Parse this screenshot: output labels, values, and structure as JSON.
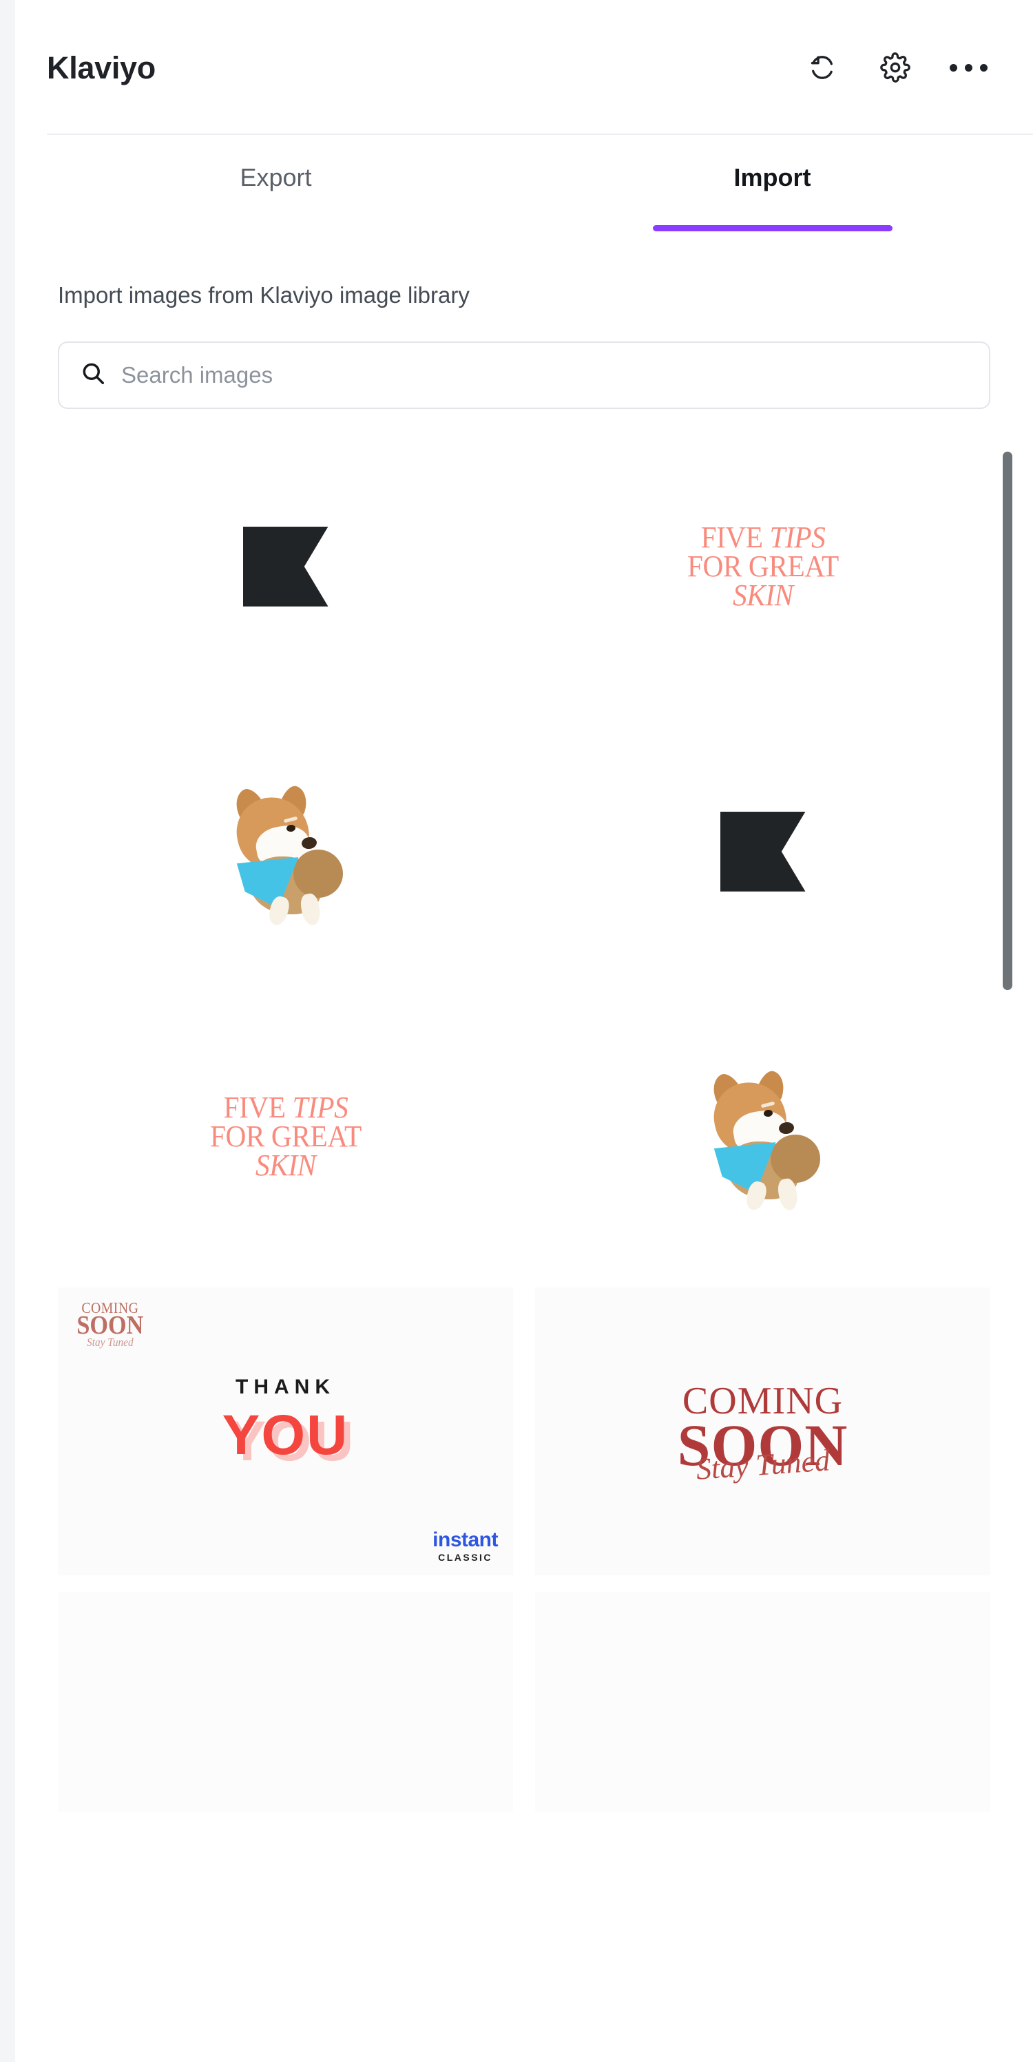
{
  "header": {
    "title": "Klaviyo",
    "actions": [
      {
        "name": "refresh-icon",
        "label": "Refresh"
      },
      {
        "name": "gear-icon",
        "label": "Settings"
      },
      {
        "name": "more-icon",
        "label": "More options"
      }
    ]
  },
  "tabs": [
    {
      "label": "Export",
      "active": false
    },
    {
      "label": "Import",
      "active": true
    }
  ],
  "main": {
    "description": "Import images from Klaviyo image library",
    "search": {
      "placeholder": "Search images",
      "value": ""
    }
  },
  "images": [
    {
      "type": "flag",
      "alt": "Black flag banner mark"
    },
    {
      "type": "tips",
      "alt": "Five Tips For Great Skin poster"
    },
    {
      "type": "dog",
      "alt": "Shiba Inu dog with blue bandana"
    },
    {
      "type": "flag",
      "alt": "Black flag banner mark"
    },
    {
      "type": "tips",
      "alt": "Five Tips For Great Skin poster"
    },
    {
      "type": "dog",
      "alt": "Shiba Inu dog with blue bandana"
    },
    {
      "type": "thankyou",
      "alt": "Thank You card"
    },
    {
      "type": "comingsoon",
      "alt": "Coming Soon Stay Tuned card"
    },
    {
      "type": "blank",
      "alt": "Untitled image"
    },
    {
      "type": "blank",
      "alt": "Untitled image"
    }
  ],
  "artwork": {
    "tips": {
      "line1_a": "FIVE ",
      "line1_b": "TIPS",
      "line2": "FOR GREAT",
      "line3": "SKIN",
      "color": "#f98b7e"
    },
    "thankyou": {
      "watermark_line1": "COMING",
      "watermark_line2": "SOON",
      "watermark_line3": "Stay Tuned",
      "thank": "THANK",
      "you": "YOU",
      "brand_line1": "instant",
      "brand_line2": "CLASSIC",
      "you_color": "#f4453f",
      "brand_color": "#2f56e0"
    },
    "comingsoon": {
      "line1": "COMING",
      "line2": "SOON",
      "line3": "Stay Tuned",
      "color": "#b03a3a"
    }
  },
  "theme": {
    "accent": "#8b3dff",
    "text": "#1f2328",
    "muted": "#5a6069",
    "border": "#e2e5e9",
    "page_bg": "#f4f5f7",
    "scrollbar": "#6e7378"
  },
  "scrollbar": {
    "name": "vertical-scrollbar"
  }
}
